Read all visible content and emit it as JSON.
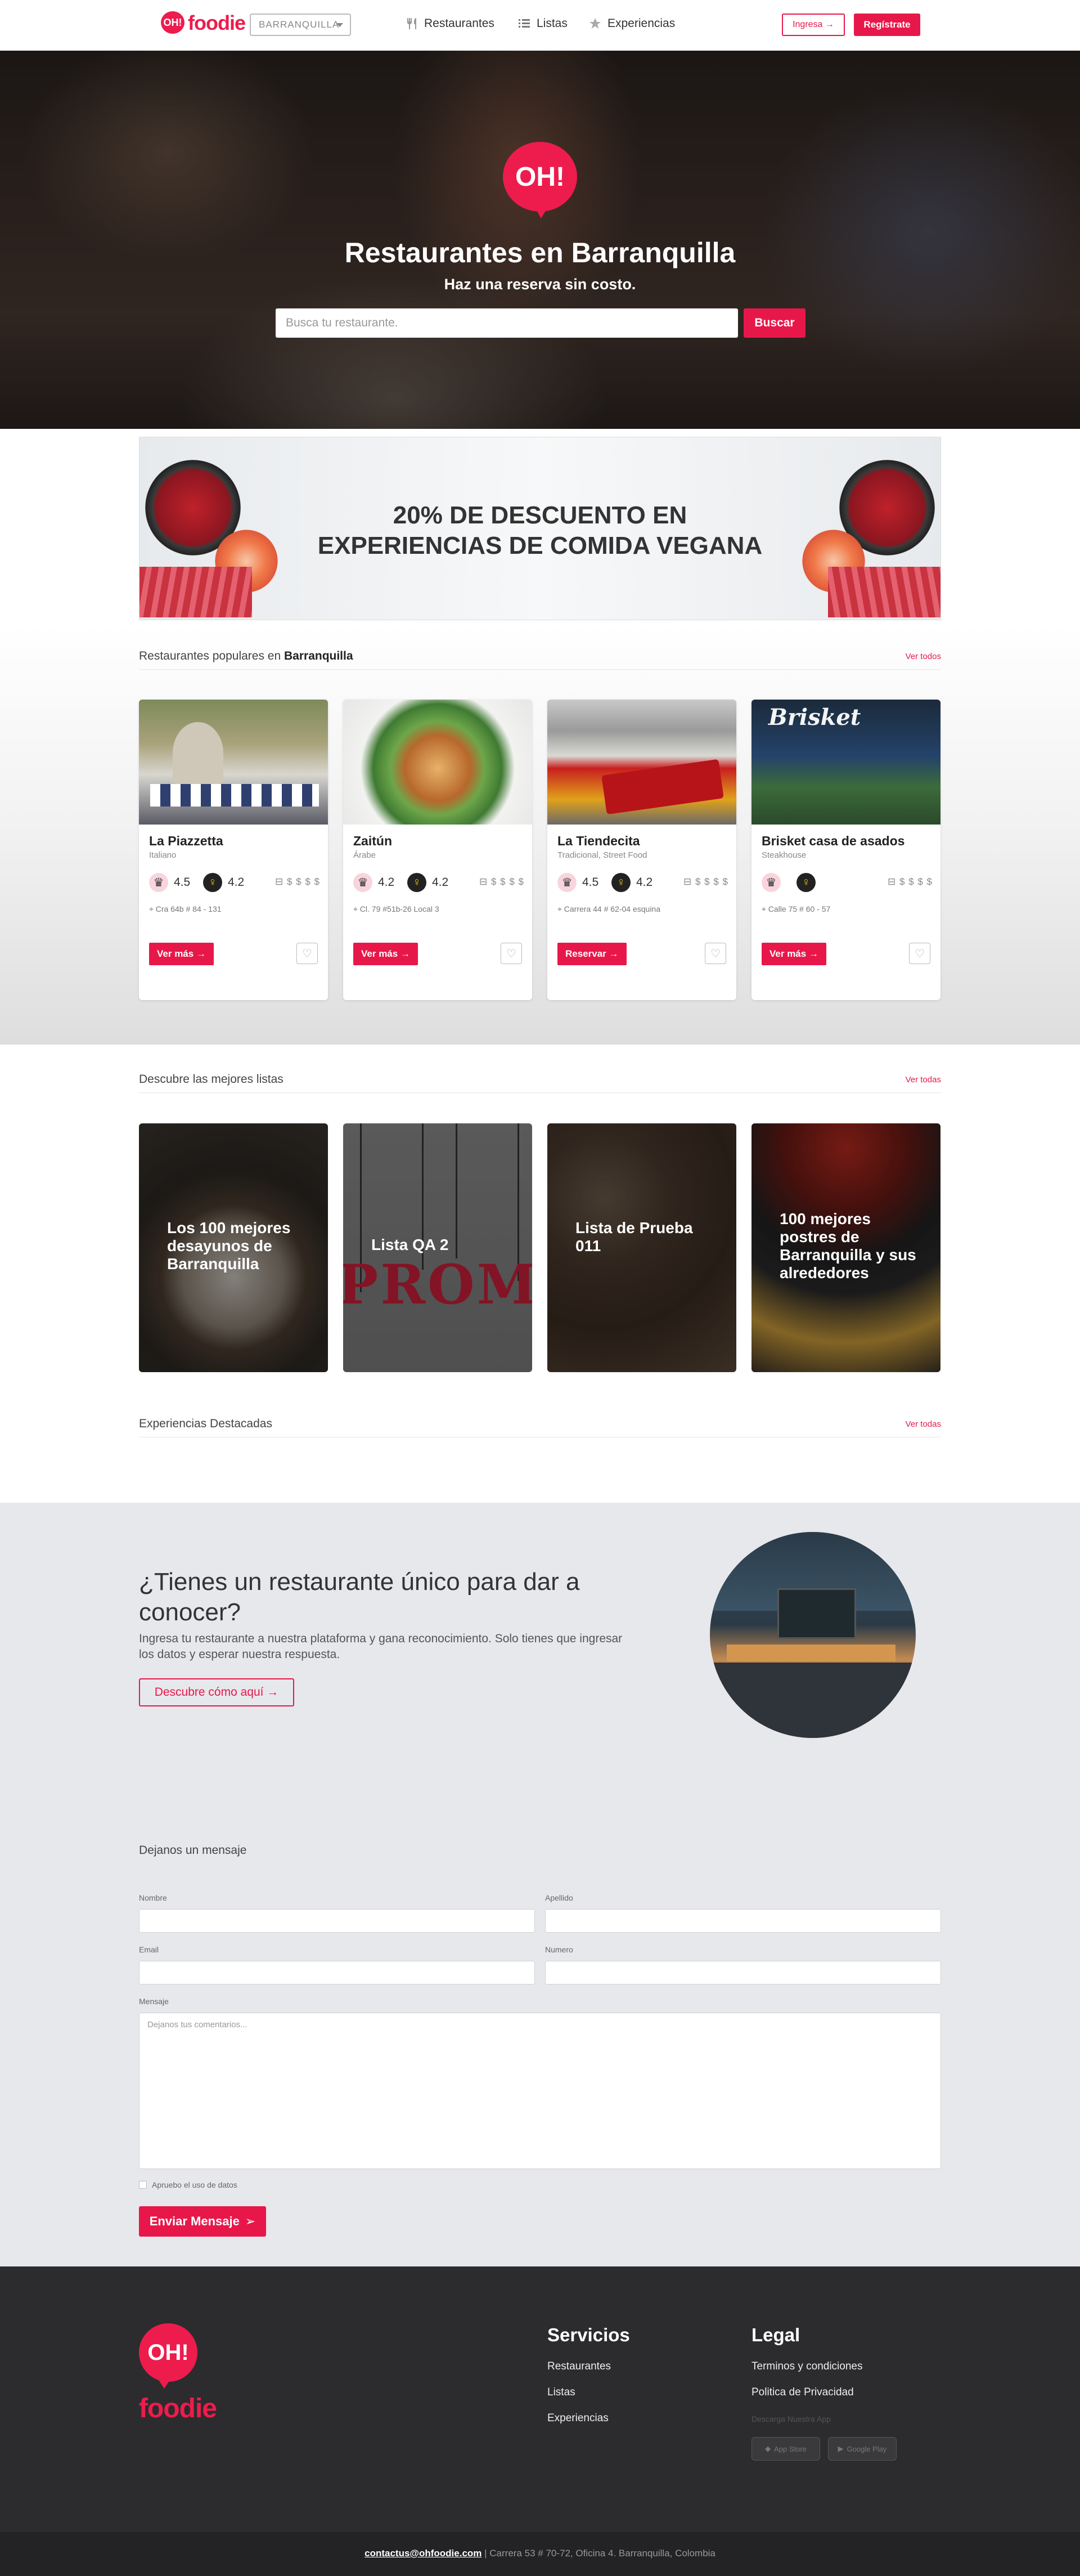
{
  "nav": {
    "logo_bubble": "OH!",
    "logo_word": "foodie",
    "city": "BARRANQUILLA",
    "links": [
      "Restaurantes",
      "Listas",
      "Experiencias"
    ],
    "login": "Ingresa",
    "register": "Regístrate"
  },
  "hero": {
    "logo": "OH!",
    "title": "Restaurantes en Barranquilla",
    "subtitle": "Haz una reserva sin costo.",
    "search_placeholder": "Busca tu restaurante.",
    "search_button": "Buscar"
  },
  "banner": {
    "line1": "20% DE DESCUENTO EN",
    "line2": "EXPERIENCIAS DE COMIDA VEGANA"
  },
  "popular": {
    "title_prefix": "Restaurantes populares en ",
    "title_city": "Barranquilla",
    "see_all": "Ver todos",
    "cards": [
      {
        "name": "La Piazzetta",
        "category": "Italiano",
        "rating1": "4.5",
        "rating2": "4.2",
        "price": "$ $ $ $",
        "address": "Cra 64b # 84 - 131",
        "button": "Ver más"
      },
      {
        "name": "Zaitún",
        "category": "Árabe",
        "rating1": "4.2",
        "rating2": "4.2",
        "price": "$ $ $ $",
        "address": "Cl. 79 #51b-26 Local 3",
        "button": "Ver más"
      },
      {
        "name": "La Tiendecita",
        "category": "Tradicional, Street Food",
        "rating1": "4.5",
        "rating2": "4.2",
        "price": "$ $ $ $",
        "address": "Carrera 44 # 62-04 esquina",
        "button": "Reservar"
      },
      {
        "name": "Brisket casa de asados",
        "category": "Steakhouse",
        "rating1": "",
        "rating2": "",
        "price": "$ $ $ $",
        "address": "Calle 75 # 60 - 57",
        "button": "Ver más",
        "sign": "Brisket"
      }
    ]
  },
  "lists": {
    "title": "Descubre las mejores listas",
    "see_all": "Ver todas",
    "items": [
      "Los 100 mejores desayunos de Barranquilla",
      "Lista QA 2",
      "Lista de Prueba 011",
      "100 mejores postres de Barranquilla y sus alrededores"
    ],
    "promo_letters": "PROMO"
  },
  "experiences": {
    "title": "Experiencias Destacadas",
    "see_all": "Ver todas"
  },
  "cta": {
    "title": "¿Tienes un restaurante único para dar a conocer?",
    "description": "Ingresa tu restaurante a nuestra plataforma y gana reconocimiento. Solo tienes que ingresar los datos y esperar nuestra respuesta.",
    "button": "Descubre cómo aquí"
  },
  "form": {
    "title": "Dejanos un mensaje",
    "nombre": "Nombre",
    "apellido": "Apellido",
    "email": "Email",
    "numero": "Numero",
    "mensaje": "Mensaje",
    "mensaje_placeholder": "Dejanos tus comentarios...",
    "consent": "Apruebo el uso de datos",
    "submit": "Enviar Mensaje"
  },
  "footer": {
    "logo_bubble": "OH!",
    "logo_word": "foodie",
    "services_title": "Servicios",
    "services": [
      "Restaurantes",
      "Listas",
      "Experiencias"
    ],
    "legal_title": "Legal",
    "legal": [
      "Terminos y condiciones",
      "Politica de Privacidad"
    ],
    "download": "Descarga Nuestra App",
    "appstore": "App Store",
    "googleplay": "Google Play",
    "email": "contactus@ohfoodie.com",
    "address": " | Carrera 53 # 70-72, Oficina 4. Barranquilla, Colombia"
  },
  "colors": {
    "brand": "#e8174a",
    "footer": "#2c2c2e",
    "contact_bg": "#e7e8ec"
  }
}
